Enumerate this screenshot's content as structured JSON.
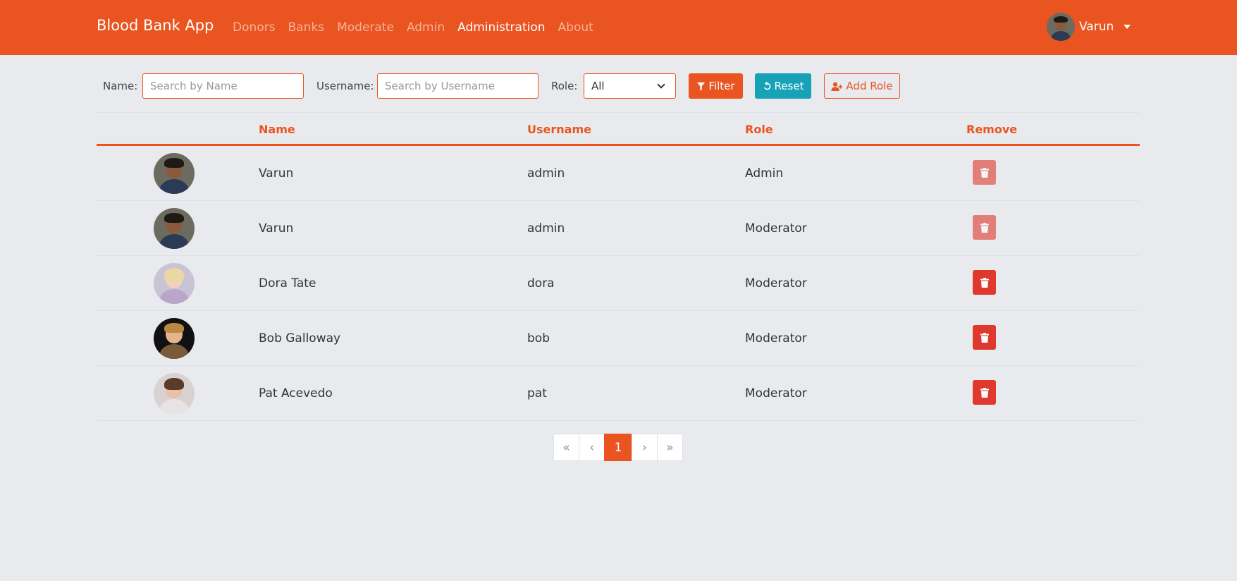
{
  "navbar": {
    "brand": "Blood Bank App",
    "links": [
      {
        "label": "Donors",
        "active": false
      },
      {
        "label": "Banks",
        "active": false
      },
      {
        "label": "Moderate",
        "active": false
      },
      {
        "label": "Admin",
        "active": false
      },
      {
        "label": "Administration",
        "active": true
      },
      {
        "label": "About",
        "active": false
      }
    ],
    "user": {
      "name": "Varun",
      "icon": "user-avatar"
    }
  },
  "filters": {
    "name_label": "Name:",
    "name_placeholder": "Search by Name",
    "name_value": "",
    "username_label": "Username:",
    "username_placeholder": "Search by Username",
    "username_value": "",
    "role_label": "Role:",
    "role_selected": "All",
    "filter_button": "Filter",
    "reset_button": "Reset",
    "add_role_button": "Add Role"
  },
  "table": {
    "headers": {
      "avatar": "",
      "name": "Name",
      "username": "Username",
      "role": "Role",
      "remove": "Remove"
    },
    "rows": [
      {
        "name": "Varun",
        "username": "admin",
        "role": "Admin",
        "removable": false,
        "avatar": "male-avatar-dark"
      },
      {
        "name": "Varun",
        "username": "admin",
        "role": "Moderator",
        "removable": false,
        "avatar": "male-avatar-dark"
      },
      {
        "name": "Dora Tate",
        "username": "dora",
        "role": "Moderator",
        "removable": true,
        "avatar": "female-avatar-blonde"
      },
      {
        "name": "Bob Galloway",
        "username": "bob",
        "role": "Moderator",
        "removable": true,
        "avatar": "male-avatar-light"
      },
      {
        "name": "Pat Acevedo",
        "username": "pat",
        "role": "Moderator",
        "removable": true,
        "avatar": "female-avatar-brunette"
      }
    ]
  },
  "pagination": {
    "first": "«",
    "prev": "‹",
    "current": "1",
    "next": "›",
    "last": "»"
  },
  "colors": {
    "primary": "#e95420",
    "info": "#17a2b8",
    "danger": "#df382c",
    "background": "#e8eaed"
  }
}
